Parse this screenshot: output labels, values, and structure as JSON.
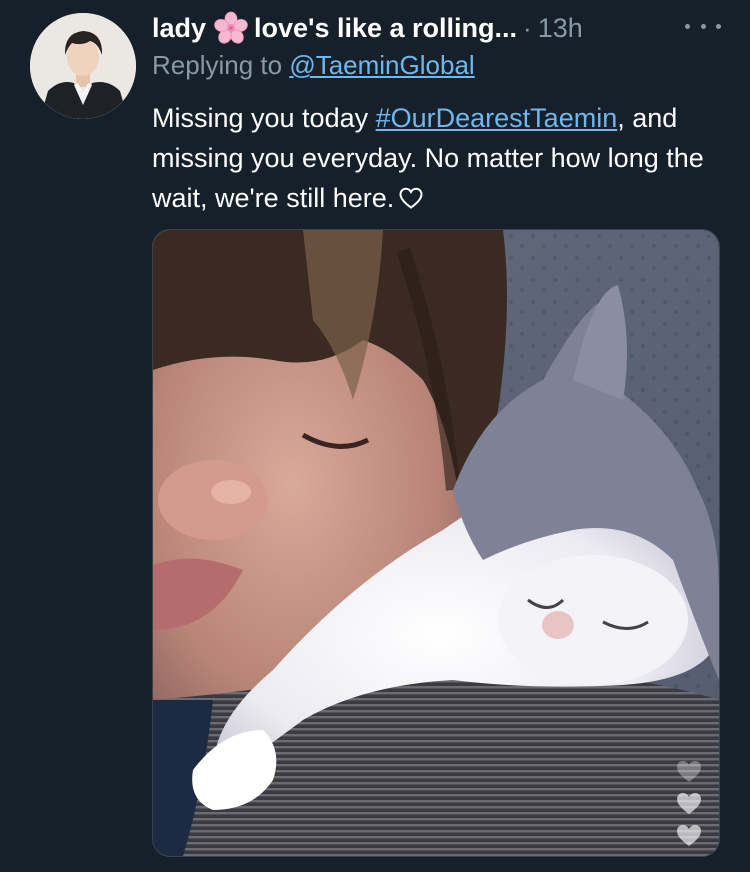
{
  "tweet": {
    "display_name_prefix": "lady",
    "display_name_suffix": "love's like a rolling...",
    "separator": "·",
    "timestamp": "13h",
    "replying_to_label": "Replying to",
    "replying_to_handle": "@TaeminGlobal",
    "text_part1": "Missing you today ",
    "hashtag": "#OurDearestTaemin",
    "text_part2": ", and missing you everyday. No matter how long the wait, we're still here."
  },
  "icons": {
    "name_emoji": "cherry-blossom-icon",
    "more": "more-options-icon",
    "text_emoji": "white-heart-icon"
  },
  "colors": {
    "background": "#15202b",
    "secondary_text": "#8899a6",
    "link": "#6fb8ee",
    "primary_text": "#ffffff"
  }
}
